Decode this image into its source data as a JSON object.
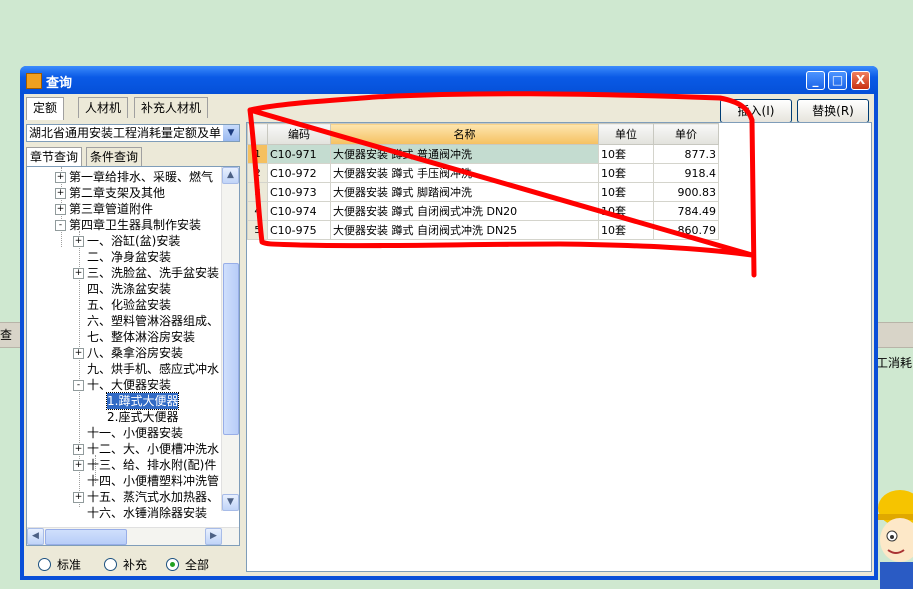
{
  "window": {
    "title": "查询",
    "minimize": "_",
    "maximize": "□",
    "close": "X"
  },
  "tabs": [
    "定额",
    "人材机",
    "补充人材机"
  ],
  "buttons": {
    "insert": "插入(I)",
    "replace": "替换(R)"
  },
  "library_select": {
    "value": "湖北省通用安装工程消耗量定额及单"
  },
  "subtabs": [
    "章节查询",
    "条件查询"
  ],
  "tree": [
    {
      "label": "第一章给排水、采暖、燃气",
      "toggle": "+"
    },
    {
      "label": "第二章支架及其他",
      "toggle": "+"
    },
    {
      "label": "第三章管道附件",
      "toggle": "+"
    },
    {
      "label": "第四章卫生器具制作安装",
      "toggle": "-"
    },
    {
      "label": "一、浴缸(盆)安装",
      "toggle": "+"
    },
    {
      "label": "二、净身盆安装",
      "toggle": ""
    },
    {
      "label": "三、洗脸盆、洗手盆安装",
      "toggle": "+"
    },
    {
      "label": "四、洗涤盆安装",
      "toggle": ""
    },
    {
      "label": "五、化验盆安装",
      "toggle": ""
    },
    {
      "label": "六、塑料管淋浴器组成、",
      "toggle": ""
    },
    {
      "label": "七、整体淋浴房安装",
      "toggle": ""
    },
    {
      "label": "八、桑拿浴房安装",
      "toggle": "+"
    },
    {
      "label": "九、烘手机、感应式冲水",
      "toggle": ""
    },
    {
      "label": "十、大便器安装",
      "toggle": "-"
    },
    {
      "label": "1.蹲式大便器",
      "toggle": ""
    },
    {
      "label": "2.座式大便器",
      "toggle": ""
    },
    {
      "label": "十一、小便器安装",
      "toggle": ""
    },
    {
      "label": "十二、大、小便槽冲洗水",
      "toggle": "+"
    },
    {
      "label": "十三、给、排水附(配)件",
      "toggle": "+"
    },
    {
      "label": "十四、小便槽塑料冲洗管",
      "toggle": ""
    },
    {
      "label": "十五、蒸汽式水加热器、",
      "toggle": "+"
    },
    {
      "label": "十六、水锤消除器安装",
      "toggle": ""
    }
  ],
  "radios": {
    "options": [
      "标准",
      "补充",
      "全部"
    ],
    "selected": "全部"
  },
  "grid": {
    "headers": [
      "编码",
      "名称",
      "单位",
      "单价"
    ],
    "rows": [
      {
        "no": "1",
        "code": "C10-971",
        "name": "大便器安装 蹲式 普通阀冲洗",
        "unit": "10套",
        "price": "877.3"
      },
      {
        "no": "2",
        "code": "C10-972",
        "name": "大便器安装 蹲式 手压阀冲洗",
        "unit": "10套",
        "price": "918.4"
      },
      {
        "no": "3",
        "code": "C10-973",
        "name": "大便器安装 蹲式 脚踏阀冲洗",
        "unit": "10套",
        "price": "900.83"
      },
      {
        "no": "4",
        "code": "C10-974",
        "name": "大便器安装 蹲式 自闭阀式冲洗 DN20",
        "unit": "10套",
        "price": "784.49"
      },
      {
        "no": "5",
        "code": "C10-975",
        "name": "大便器安装 蹲式 自闭阀式冲洗 DN25",
        "unit": "10套",
        "price": "860.79"
      }
    ]
  },
  "background": {
    "left_tab": "查",
    "right_text": "工消耗"
  },
  "colors": {
    "title_bar": "#0a5ae6",
    "selection": "#316ac5",
    "annotation": "#ff0000",
    "client": "#ece9d8"
  }
}
